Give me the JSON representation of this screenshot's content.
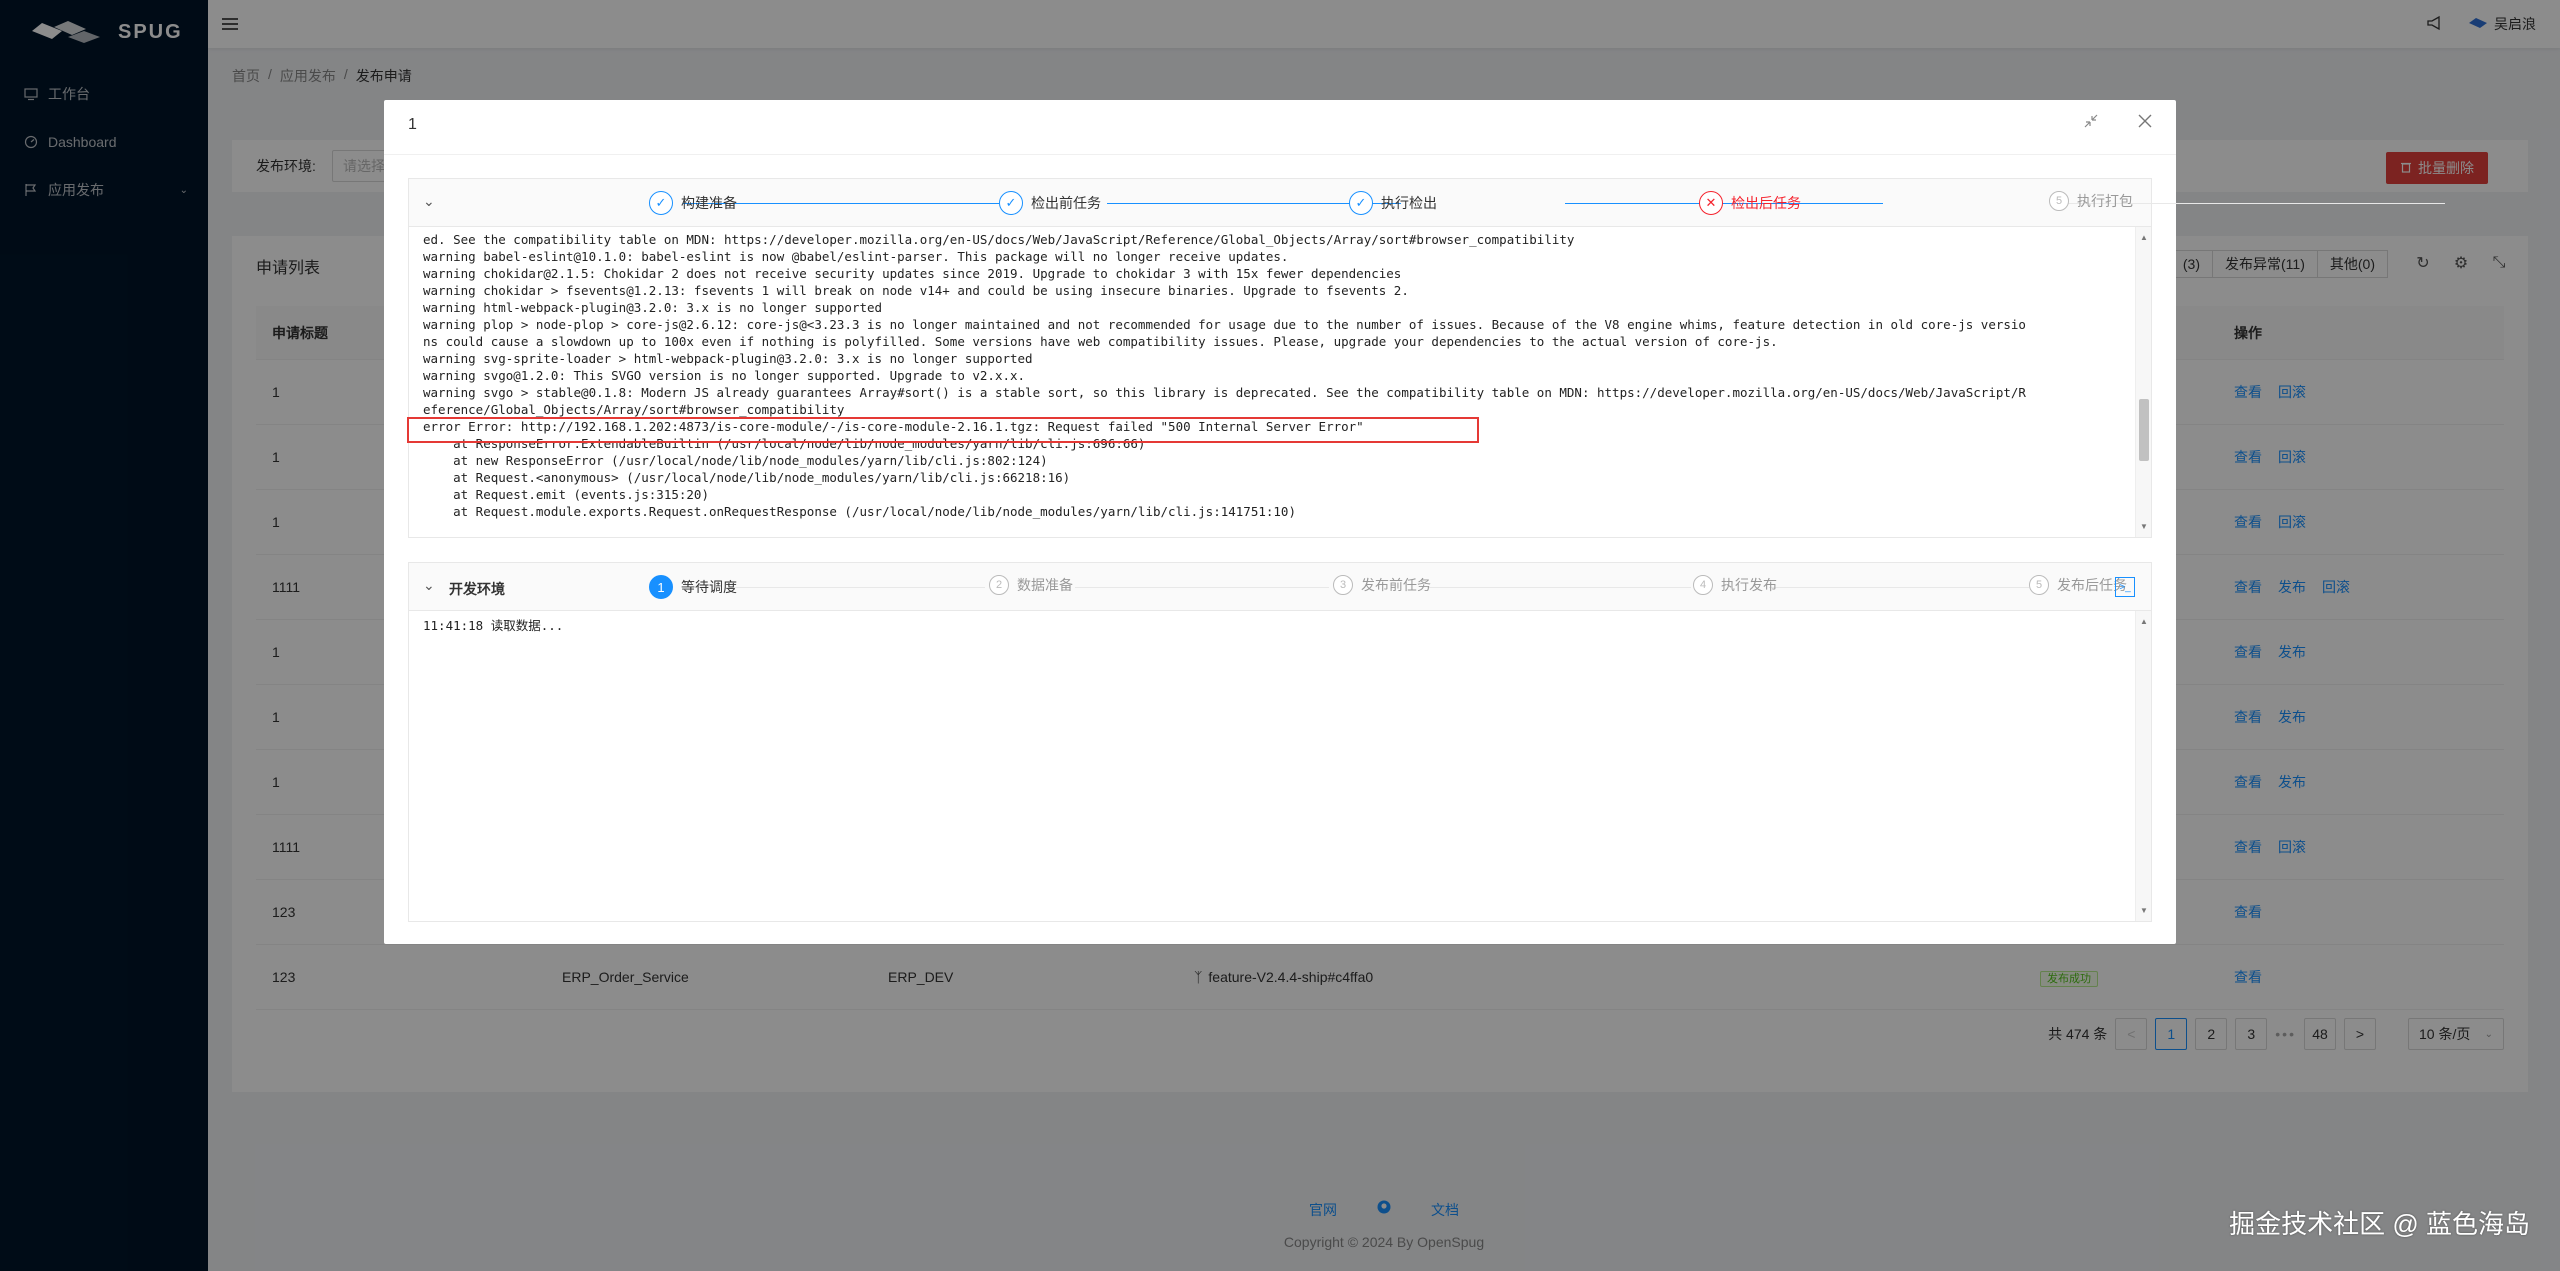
{
  "app": {
    "logo_text": "SPUG",
    "menu": [
      {
        "label": "工作台",
        "icon": "desktop-icon"
      },
      {
        "label": "Dashboard",
        "icon": "dashboard-icon"
      },
      {
        "label": "应用发布",
        "icon": "flag-icon"
      }
    ]
  },
  "header": {
    "user_name": "吴启浪"
  },
  "breadcrumb": [
    "首页",
    "应用发布",
    "发布申请"
  ],
  "filter": {
    "label": "发布环境:",
    "placeholder": "请选择",
    "batch_delete": "批量删除"
  },
  "list": {
    "title": "申请列表",
    "tabs": [
      "(3)",
      "发布异常(11)",
      "其他(0)"
    ],
    "columns": {
      "title": "申请标题",
      "ops": "操作"
    },
    "rows": [
      {
        "title": "1",
        "ops": [
          "查看",
          "回滚"
        ]
      },
      {
        "title": "1",
        "ops": [
          "查看",
          "回滚"
        ]
      },
      {
        "title": "1",
        "ops": [
          "查看",
          "回滚"
        ]
      },
      {
        "title": "1111",
        "ops": [
          "查看",
          "发布",
          "回滚"
        ]
      },
      {
        "title": "1",
        "ops": [
          "查看",
          "发布"
        ]
      },
      {
        "title": "1",
        "ops": [
          "查看",
          "发布"
        ]
      },
      {
        "title": "1",
        "ops": [
          "查看",
          "发布"
        ]
      },
      {
        "title": "1111",
        "ops": [
          "查看",
          "回滚"
        ]
      },
      {
        "title": "123",
        "ops": [
          "查看"
        ]
      },
      {
        "title": "123",
        "app": "ERP_Order_Service",
        "env": "ERP_DEV",
        "version": "feature-V2.4.4-ship#c4ffa0",
        "status": "发布成功",
        "ops": [
          "查看"
        ]
      }
    ],
    "pagination": {
      "total": "共 474 条",
      "prev": "<",
      "pages": [
        "1",
        "2",
        "3"
      ],
      "ellipsis": "•••",
      "last": "48",
      "next": ">",
      "page_size": "10 条/页",
      "current": "1"
    }
  },
  "footer": {
    "links": [
      "官网",
      "文档"
    ],
    "copyright": "Copyright © 2024 By OpenSpug"
  },
  "watermark": "掘金技术社区 @ 蓝色海岛",
  "modal": {
    "title": "1",
    "build_panel": {
      "steps": [
        {
          "label": "构建准备",
          "state": "done"
        },
        {
          "label": "检出前任务",
          "state": "done"
        },
        {
          "label": "执行检出",
          "state": "done"
        },
        {
          "label": "检出后任务",
          "state": "error"
        },
        {
          "label": "执行打包",
          "state": "wait",
          "num": "5"
        }
      ],
      "log_lines": [
        "ed. See the compatibility table on MDN: https://developer.mozilla.org/en-US/docs/Web/JavaScript/Reference/Global_Objects/Array/sort#browser_compatibility",
        "warning babel-eslint@10.1.0: babel-eslint is now @babel/eslint-parser. This package will no longer receive updates.",
        "warning chokidar@2.1.5: Chokidar 2 does not receive security updates since 2019. Upgrade to chokidar 3 with 15x fewer dependencies",
        "warning chokidar > fsevents@1.2.13: fsevents 1 will break on node v14+ and could be using insecure binaries. Upgrade to fsevents 2.",
        "warning html-webpack-plugin@3.2.0: 3.x is no longer supported",
        "warning plop > node-plop > core-js@2.6.12: core-js@<3.23.3 is no longer maintained and not recommended for usage due to the number of issues. Because of the V8 engine whims, feature detection in old core-js versio",
        "ns could cause a slowdown up to 100x even if nothing is polyfilled. Some versions have web compatibility issues. Please, upgrade your dependencies to the actual version of core-js.",
        "warning svg-sprite-loader > html-webpack-plugin@3.2.0: 3.x is no longer supported",
        "warning svgo@1.2.0: This SVGO version is no longer supported. Upgrade to v2.x.x.",
        "warning svgo > stable@0.1.8: Modern JS already guarantees Array#sort() is a stable sort, so this library is deprecated. See the compatibility table on MDN: https://developer.mozilla.org/en-US/docs/Web/JavaScript/R",
        "eference/Global_Objects/Array/sort#browser_compatibility",
        "error Error: http://192.168.1.202:4873/is-core-module/-/is-core-module-2.16.1.tgz: Request failed \"500 Internal Server Error\"",
        "    at ResponseError.ExtendableBuiltin (/usr/local/node/lib/node_modules/yarn/lib/cli.js:696:66)",
        "    at new ResponseError (/usr/local/node/lib/node_modules/yarn/lib/cli.js:802:124)",
        "    at Request.<anonymous> (/usr/local/node/lib/node_modules/yarn/lib/cli.js:66218:16)",
        "    at Request.emit (events.js:315:20)",
        "    at Request.module.exports.Request.onRequestResponse (/usr/local/node/lib/node_modules/yarn/lib/cli.js:141751:10)"
      ]
    },
    "deploy_panel": {
      "env_label": "开发环境",
      "steps": [
        {
          "label": "等待调度",
          "state": "active",
          "num": "1"
        },
        {
          "label": "数据准备",
          "state": "wait",
          "num": "2"
        },
        {
          "label": "发布前任务",
          "state": "wait",
          "num": "3"
        },
        {
          "label": "执行发布",
          "state": "wait",
          "num": "4"
        },
        {
          "label": "发布后任务",
          "state": "wait",
          "num": "5"
        }
      ],
      "log_lines": [
        "11:41:18 读取数据..."
      ]
    }
  },
  "colors": {
    "primary": "#1890ff",
    "error": "#f5222d",
    "sidebar": "#001529",
    "danger_button": "#e2413c"
  }
}
